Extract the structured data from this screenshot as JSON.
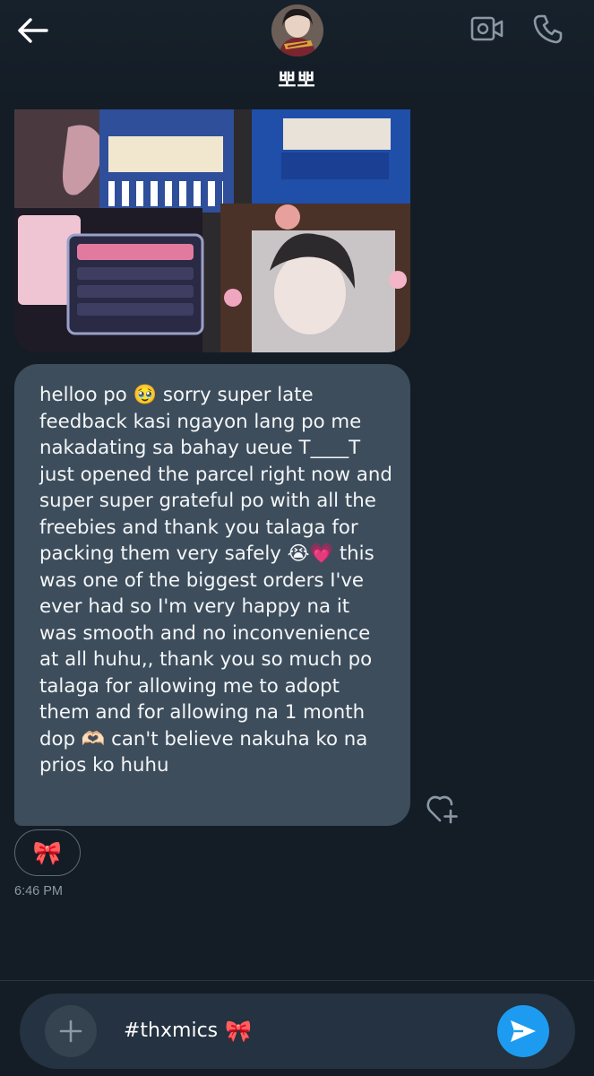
{
  "header": {
    "contact_name": "뽀뽀",
    "icons": {
      "back": "back-arrow-icon",
      "video": "video-call-icon",
      "call": "phone-call-icon"
    }
  },
  "messages": {
    "photo_icon": "photo-attachment",
    "text": "helloo po 🥹 sorry super late feedback kasi ngayon lang po me nakadating sa bahay ueue T____T just opened the parcel right now and super super grateful po with all the freebies and thank you talaga for packing them very safely 😭💗 this was one of the biggest orders I've ever had so I'm very happy na it was smooth and no inconvenience at all huhu,, thank you so much po talaga for allowing me to adopt them and for allowing na 1 month dop 🫶🏻 can't believe nakuha ko na prios ko huhu",
    "reaction": "🎀",
    "timestamp": "6:46 PM"
  },
  "composer": {
    "input_value": "#thxmics",
    "input_emoji": "🎀"
  },
  "colors": {
    "background": "#141d26",
    "bubble": "#3d4d5c",
    "send_button": "#1d9bf0",
    "composer": "#243241"
  }
}
